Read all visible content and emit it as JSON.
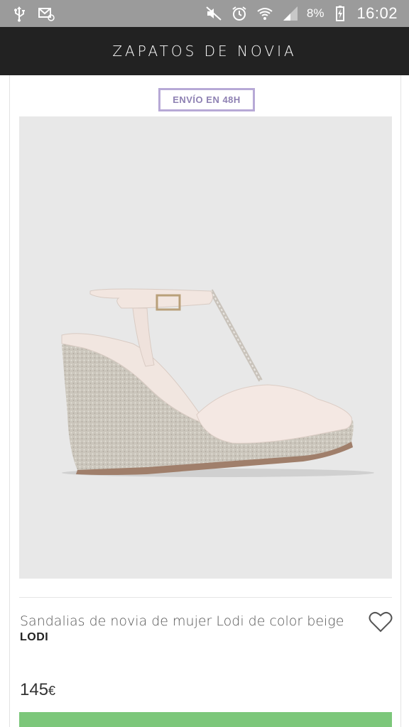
{
  "status_bar": {
    "left_icons": [
      "usb-icon",
      "email-icon"
    ],
    "right_icons": [
      "mute-icon",
      "alarm-icon",
      "wifi-icon",
      "signal-icon",
      "battery-charging-icon"
    ],
    "battery": "8%",
    "time": "16:02"
  },
  "header": {
    "title": "ZAPATOS DE NOVIA"
  },
  "product": {
    "badge": "ENVÍO EN 48H",
    "image_icon": "wedge-sandal-image",
    "name": "Sandalias de novia de mujer Lodi de color beige",
    "brand": "LODI",
    "price": "145",
    "currency": "€",
    "favorite_icon": "heart-icon"
  },
  "colors": {
    "header_bg": "#222222",
    "status_bar_bg": "#9b9b9b",
    "badge": "#b7a9d6",
    "cta": "#7cc77a"
  }
}
